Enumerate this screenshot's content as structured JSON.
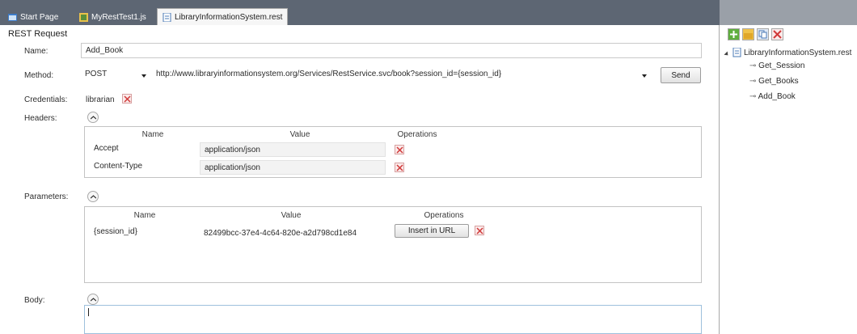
{
  "tabs": [
    {
      "label": "Start Page"
    },
    {
      "label": "MyRestTest1.js"
    },
    {
      "label": "LibraryInformationSystem.rest"
    }
  ],
  "request": {
    "section_title": "REST Request",
    "name_label": "Name:",
    "name_value": "Add_Book",
    "method_label": "Method:",
    "method_value": "POST",
    "url_value": "http://www.libraryinformationsystem.org/Services/RestService.svc/book?session_id={session_id}",
    "send_label": "Send",
    "credentials_label": "Credentials:",
    "credentials_value": "librarian",
    "headers_label": "Headers:",
    "parameters_label": "Parameters:",
    "body_label": "Body:",
    "body_value": ""
  },
  "headers_table": {
    "columns": [
      "Name",
      "Value",
      "Operations"
    ],
    "rows": [
      {
        "name": "Accept",
        "value": "application/json"
      },
      {
        "name": "Content-Type",
        "value": "application/json"
      }
    ]
  },
  "parameters_table": {
    "columns": [
      "Name",
      "Value",
      "Operations"
    ],
    "rows": [
      {
        "name": "{session_id}",
        "value": "82499bcc-37e4-4c64-820e-a2d798cd1e84",
        "operation": "Insert in URL"
      }
    ]
  },
  "tree": {
    "root": "LibraryInformationSystem.rest",
    "items": [
      {
        "label": "Get_Session"
      },
      {
        "label": "Get_Books"
      },
      {
        "label": "Add_Book"
      }
    ]
  },
  "colors": {
    "tabstrip": "#5d6673",
    "delete_red": "#d03a3a",
    "body_border": "#9ec0dd"
  }
}
